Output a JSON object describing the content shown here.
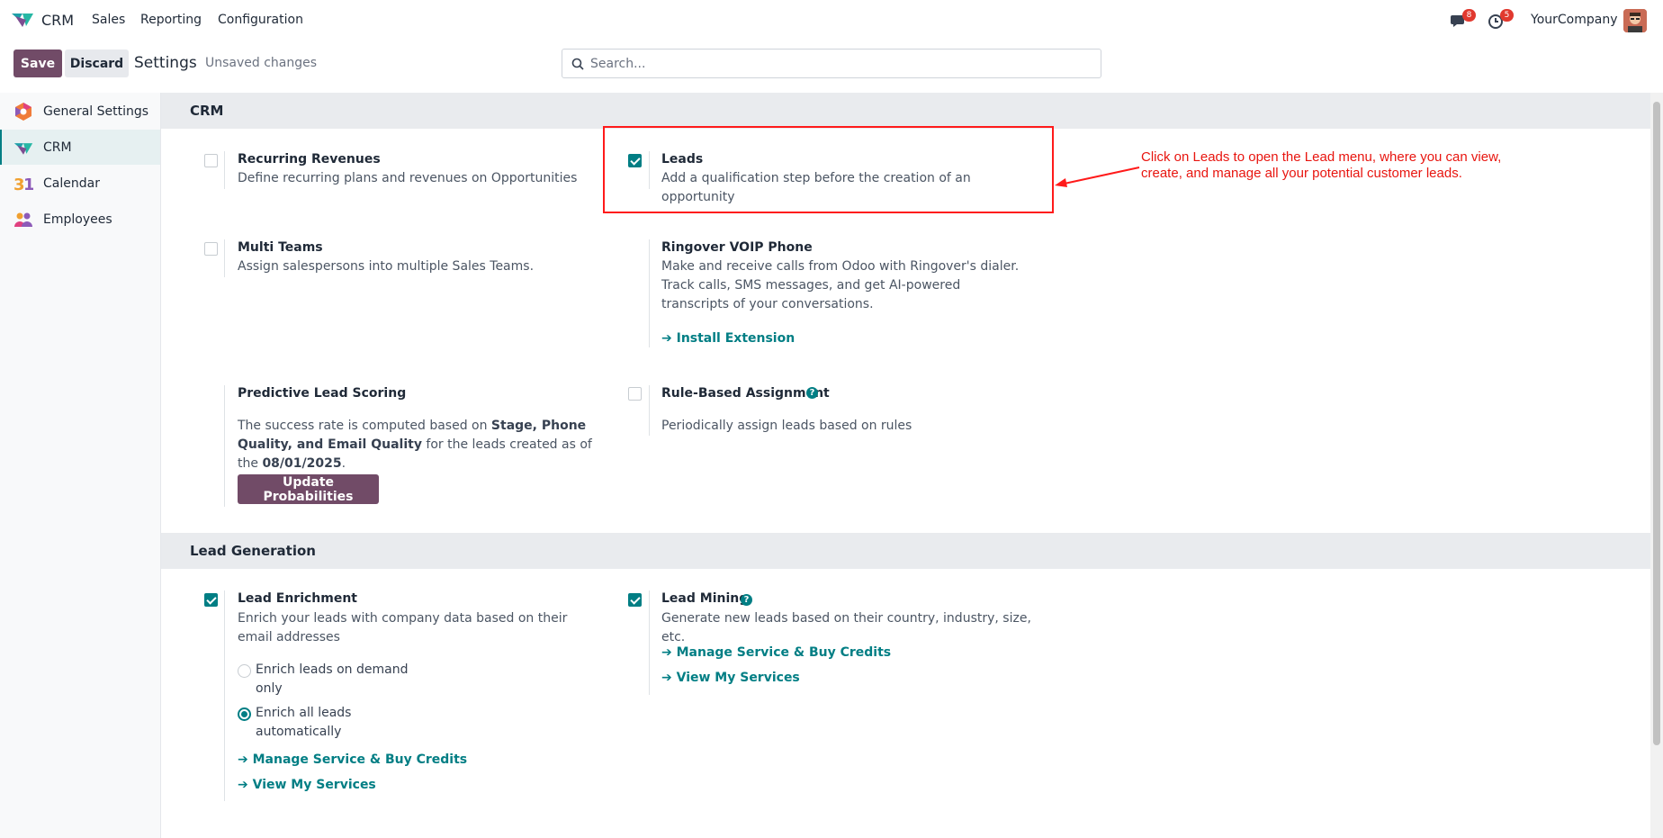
{
  "navbar": {
    "app_name": "CRM",
    "menus": [
      "Sales",
      "Reporting",
      "Configuration"
    ],
    "messages_count": "8",
    "activities_count": "5",
    "company": "YourCompany"
  },
  "control_panel": {
    "save_label": "Save",
    "discard_label": "Discard",
    "title": "Settings",
    "status": "Unsaved changes",
    "search_placeholder": "Search..."
  },
  "sidebar": {
    "items": [
      {
        "label": "General Settings",
        "icon": "odoo-settings-icon"
      },
      {
        "label": "CRM",
        "icon": "crm-icon",
        "active": true
      },
      {
        "label": "Calendar",
        "icon": "calendar-icon"
      },
      {
        "label": "Employees",
        "icon": "employees-icon"
      }
    ]
  },
  "sections": {
    "crm": {
      "title": "CRM",
      "recurring": {
        "title": "Recurring Revenues",
        "desc": "Define recurring plans and revenues on Opportunities",
        "checked": false
      },
      "leads": {
        "title": "Leads",
        "desc": "Add a qualification step before the creation of an opportunity",
        "checked": true
      },
      "multi_teams": {
        "title": "Multi Teams",
        "desc": "Assign salespersons into multiple Sales Teams.",
        "checked": false
      },
      "ringover": {
        "title": "Ringover VOIP Phone",
        "desc": "Make and receive calls from Odoo with Ringover's dialer. Track calls, SMS messages, and get AI-powered transcripts of your conversations.",
        "link": "Install Extension"
      },
      "predictive": {
        "title": "Predictive Lead Scoring",
        "desc_part1": "The success rate is computed based on ",
        "desc_bold1": "Stage, Phone Quality, and Email Quality",
        "desc_part2": " for the leads created as of the ",
        "desc_bold2": "08/01/2025",
        "desc_part3": ".",
        "button": "Update Probabilities"
      },
      "rule_based": {
        "title": "Rule-Based Assignment",
        "desc": "Periodically assign leads based on rules",
        "checked": false
      }
    },
    "lead_generation": {
      "title": "Lead Generation",
      "enrichment": {
        "title": "Lead Enrichment",
        "desc": "Enrich your leads with company data based on their email addresses",
        "checked": true,
        "options": [
          {
            "label": "Enrich leads on demand only",
            "selected": false
          },
          {
            "label": "Enrich all leads automatically",
            "selected": true
          }
        ],
        "link1": "Manage Service & Buy Credits",
        "link2": "View My Services"
      },
      "mining": {
        "title": "Lead Mining",
        "desc": "Generate new leads based on their country, industry, size, etc.",
        "checked": true,
        "link1": "Manage Service & Buy Credits",
        "link2": "View My Services"
      }
    }
  },
  "annotation": {
    "text": "Click on Leads to open the Lead menu, where you can view, create, and manage all your potential customer leads.",
    "color": "#e8150f"
  },
  "colors": {
    "brand": "#714b67",
    "accent": "#017e84"
  }
}
